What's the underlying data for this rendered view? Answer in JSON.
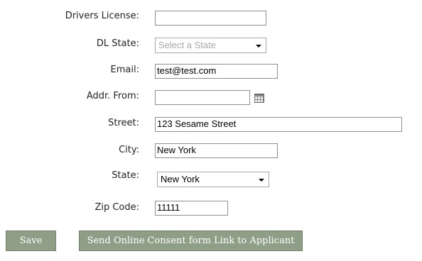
{
  "form": {
    "drivers_license": {
      "label": "Drivers License:",
      "value": ""
    },
    "dl_state": {
      "label": "DL State:",
      "placeholder": "Select a State"
    },
    "email": {
      "label": "Email:",
      "value": "test@test.com"
    },
    "addr_from": {
      "label": "Addr. From:",
      "value": ""
    },
    "street": {
      "label": "Street:",
      "value": "123 Sesame Street"
    },
    "city": {
      "label": "City:",
      "value": "New York"
    },
    "state": {
      "label": "State:",
      "value": "New York"
    },
    "zip": {
      "label": "Zip Code:",
      "value": "11111"
    }
  },
  "buttons": {
    "save": "Save",
    "send_consent": "Send Online Consent form Link to Applicant"
  },
  "colors": {
    "button_bg": "#8f9f87",
    "button_text": "#ffffff"
  },
  "icons": {
    "addr_from_picker": "calendar-icon",
    "select_arrow": "chevron-down-icon"
  }
}
